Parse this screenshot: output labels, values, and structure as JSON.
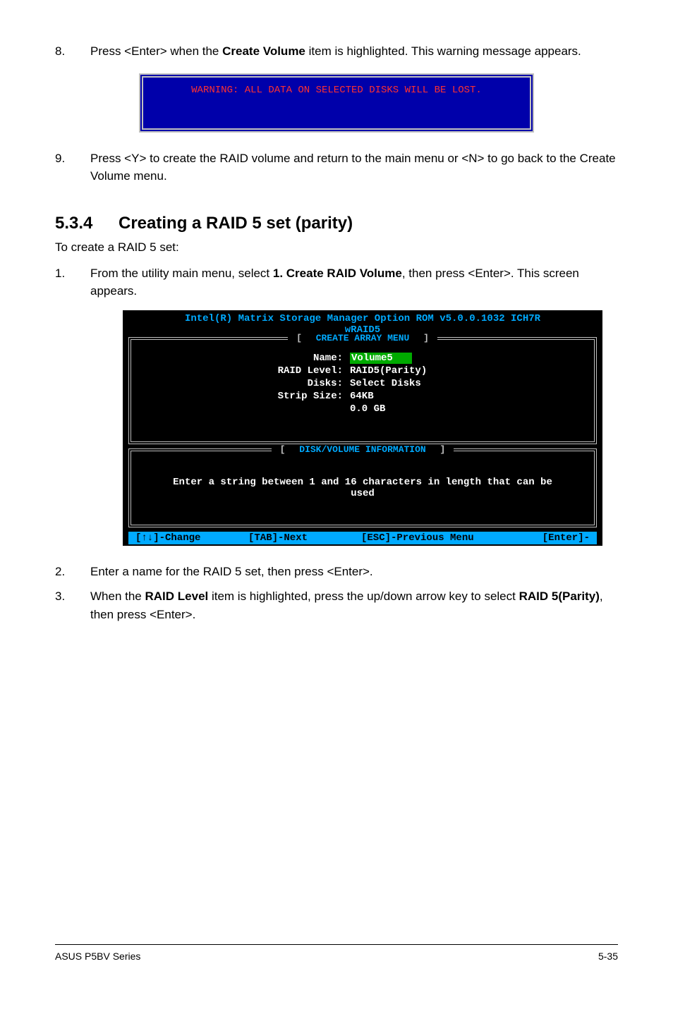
{
  "steps_top": {
    "n8": "8.",
    "t8a": "Press <Enter> when the ",
    "t8b": "Create Volume",
    "t8c": " item is highlighted. This warning message appears.",
    "n9": "9.",
    "t9": "Press <Y> to create the RAID volume and return to the main menu or <N> to go back to the Create Volume menu."
  },
  "warning_box": "WARNING: ALL DATA ON SELECTED DISKS WILL BE LOST.",
  "section": {
    "num": "5.3.4",
    "title": "Creating a RAID 5 set (parity)",
    "intro": "To create a RAID 5 set:"
  },
  "steps_mid": {
    "n1": "1.",
    "t1a": "From the utility main menu, select ",
    "t1b": "1. Create RAID Volume",
    "t1c": ", then press <Enter>. This screen appears."
  },
  "bios": {
    "title1": "Intel(R) Matrix Storage Manager Option ROM v5.0.0.1032 ICH7R",
    "title2": "wRAID5",
    "panel1_label": "CREATE ARRAY MENU",
    "rows": {
      "name_l": "Name:",
      "name_v": "Volume5",
      "raid_l": "RAID Level:",
      "raid_v": "RAID5(Parity)",
      "disks_l": "Disks:",
      "disks_v": "Select Disks",
      "strip_l": "Strip Size:",
      "strip_v": "64KB",
      "cap_l": "",
      "cap_v": "0.0  GB"
    },
    "panel2_label": "DISK/VOLUME INFORMATION",
    "info1": "Enter a string between 1 and 16 characters in length that can be",
    "info2": "used",
    "status": {
      "k1": "[↑↓]-Change",
      "k2": "[TAB]-Next",
      "k3": "[ESC]-Previous Menu",
      "k4": "[Enter]-"
    }
  },
  "steps_bottom": {
    "n2": "2.",
    "t2": "Enter a name for the RAID 5 set, then press <Enter>.",
    "n3": "3.",
    "t3a": "When the ",
    "t3b": "RAID Level",
    "t3c": " item is highlighted, press the up/down arrow key to select ",
    "t3d": "RAID 5(Parity)",
    "t3e": ", then press <Enter>."
  },
  "footer": {
    "left": "ASUS P5BV Series",
    "right": "5-35"
  }
}
